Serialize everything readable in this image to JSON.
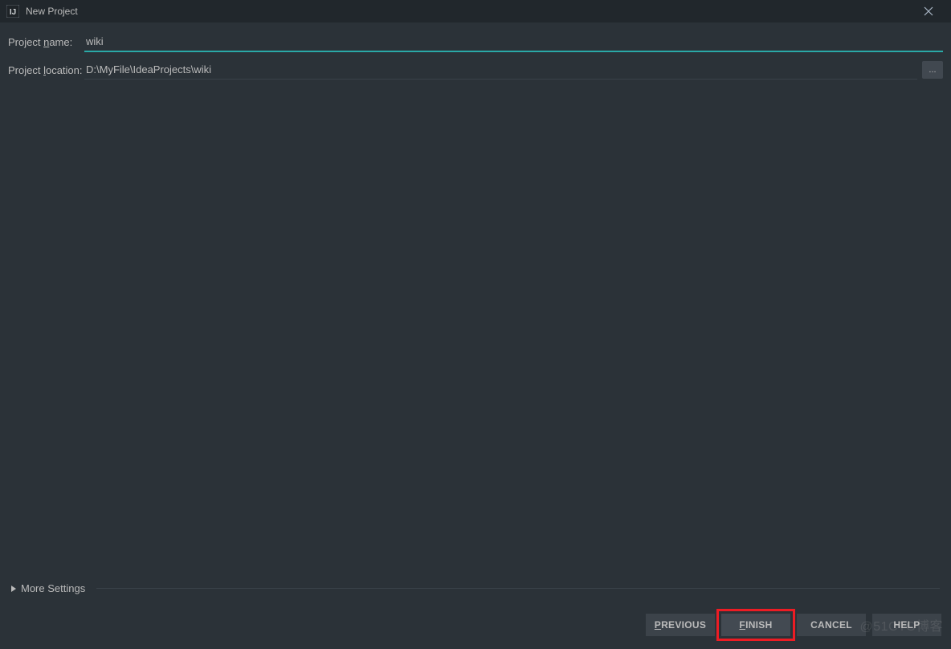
{
  "window": {
    "title": "New Project"
  },
  "form": {
    "name_label_prefix": "Project ",
    "name_label_mnemonic": "n",
    "name_label_suffix": "ame:",
    "name_value": "wiki",
    "location_label_prefix": "Project ",
    "location_label_mnemonic": "l",
    "location_label_suffix": "ocation:",
    "location_value": "D:\\MyFile\\IdeaProjects\\wiki",
    "browse_label": "..."
  },
  "more_settings": {
    "label": "More Settings"
  },
  "buttons": {
    "previous_mnemonic": "P",
    "previous_suffix": "REVIOUS",
    "finish_mnemonic": "F",
    "finish_suffix": "INISH",
    "cancel": "CANCEL",
    "help": "HELP"
  },
  "watermark": "@51CTO博客"
}
